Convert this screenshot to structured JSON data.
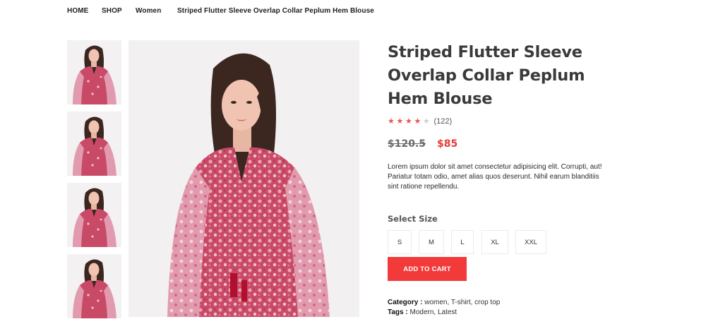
{
  "breadcrumb": {
    "items": [
      "HOME",
      "SHOP",
      "Women",
      "Striped Flutter Sleeve Overlap Collar Peplum Hem Blouse"
    ]
  },
  "product": {
    "title": "Striped Flutter Sleeve Overlap Collar Peplum Hem Blouse",
    "rating": 4,
    "rating_max": 5,
    "reviews": "(122)",
    "old_price": "$120.5",
    "new_price": "$85",
    "description": "Lorem ipsum dolor sit amet consectetur adipisicing elit. Corrupti, aut! Pariatur totam odio, amet alias quos deserunt. Nihil earum blanditiis sint ratione repellendu.",
    "size_label": "Select Size",
    "sizes": [
      "S",
      "M",
      "L",
      "XL",
      "XXL"
    ],
    "add_to_cart": "ADD TO CART",
    "category_label": "Category :",
    "category_value": "women, T-shirt, crop top",
    "tags_label": "Tags :",
    "tags_value": "Modern, Latest"
  },
  "colors": {
    "accent": "#f23a3a",
    "star": "#e8554e",
    "dress": "#c94a67"
  },
  "icons": [
    "star-icon",
    "star-empty-icon"
  ]
}
